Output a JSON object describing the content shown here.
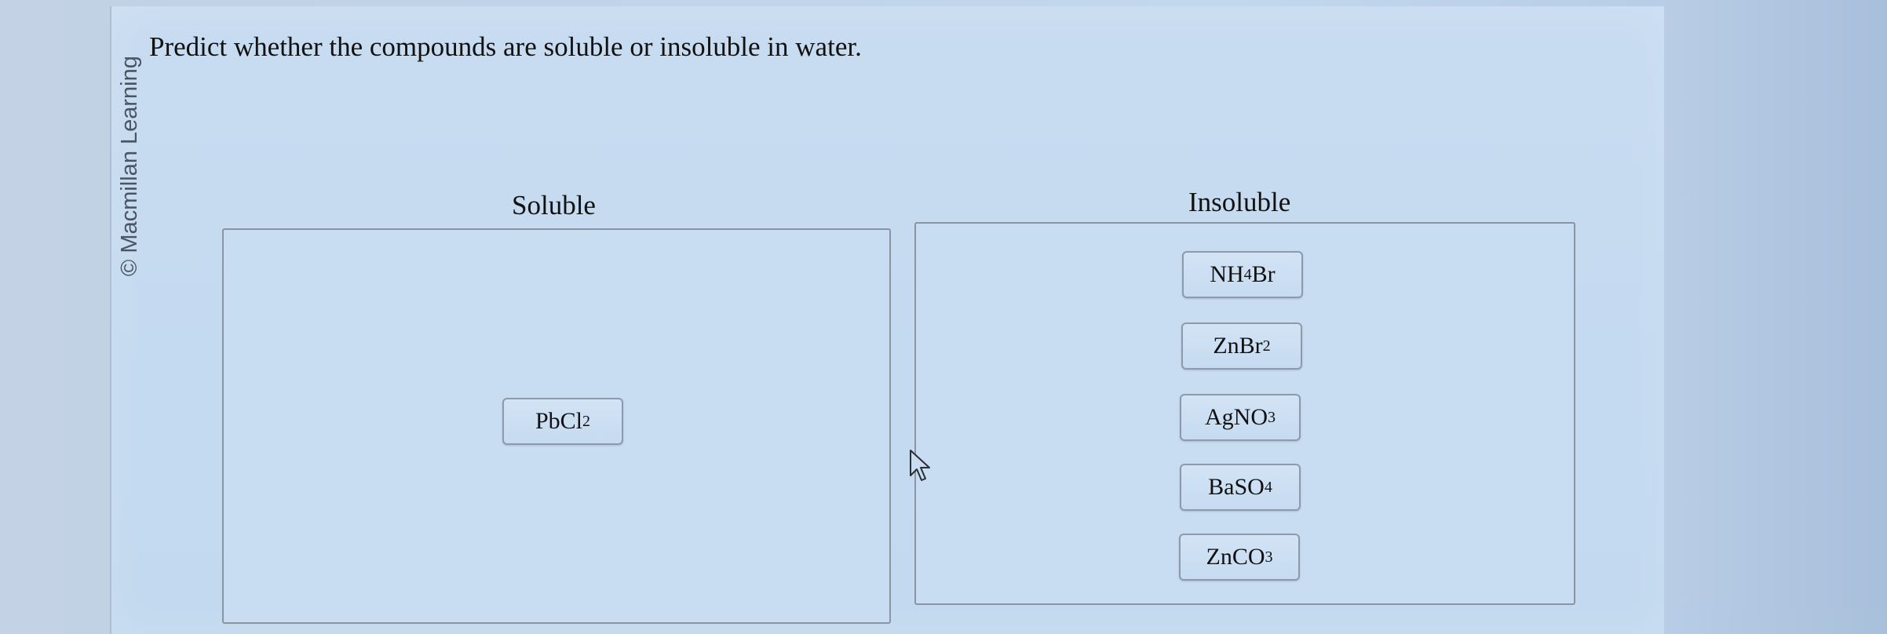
{
  "credit": "© Macmillan Learning",
  "question": "Predict whether the compounds are soluble or insoluble in water.",
  "columns": {
    "soluble_label": "Soluble",
    "insoluble_label": "Insoluble"
  },
  "soluble_items": [
    {
      "base": "PbCl",
      "sub": "2",
      "tail": ""
    }
  ],
  "insoluble_items": [
    {
      "base": "NH",
      "sub": "4",
      "tail": "Br"
    },
    {
      "base": "ZnBr",
      "sub": "2",
      "tail": ""
    },
    {
      "base": "AgNO",
      "sub": "3",
      "tail": ""
    },
    {
      "base": "BaSO",
      "sub": "4",
      "tail": ""
    },
    {
      "base": "ZnCO",
      "sub": "3",
      "tail": ""
    }
  ]
}
